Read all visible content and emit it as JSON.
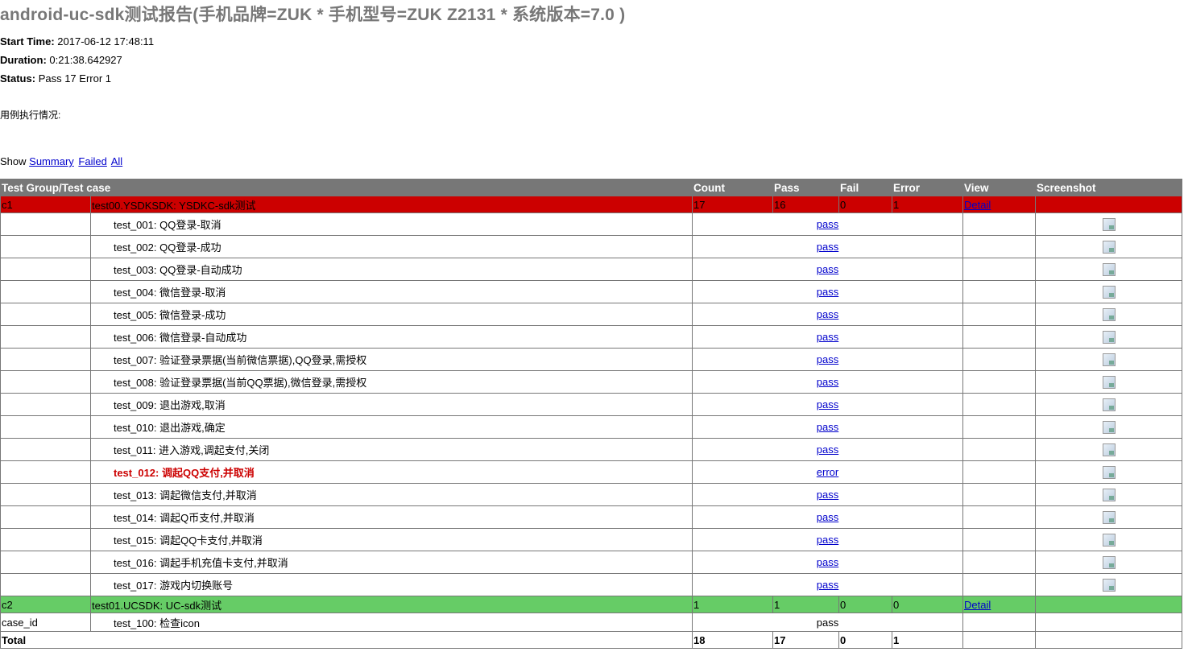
{
  "title": "android-uc-sdk测试报告(手机品牌=ZUK * 手机型号=ZUK Z2131 * 系统版本=7.0 )",
  "attributes": [
    {
      "label": "Start Time:",
      "value": "2017-06-12 17:48:11"
    },
    {
      "label": "Duration:",
      "value": "0:21:38.642927"
    },
    {
      "label": "Status:",
      "value": "Pass 17 Error 1"
    }
  ],
  "description": "用例执行情况:",
  "show": {
    "label": "Show",
    "summary": "Summary",
    "failed": "Failed",
    "all": "All"
  },
  "columns": [
    "Test Group/Test case",
    "Count",
    "Pass",
    "Fail",
    "Error",
    "View",
    "Screenshot"
  ],
  "groups": [
    {
      "id": "c1",
      "name": "test00.YSDKSDK: YSDKC-sdk测试",
      "count": "17",
      "pass": "16",
      "fail": "0",
      "error": "1",
      "view": "Detail",
      "cases": [
        {
          "name": "test_001: QQ登录-取消",
          "status": "pass"
        },
        {
          "name": "test_002: QQ登录-成功",
          "status": "pass"
        },
        {
          "name": "test_003: QQ登录-自动成功",
          "status": "pass"
        },
        {
          "name": "test_004: 微信登录-取消",
          "status": "pass"
        },
        {
          "name": "test_005: 微信登录-成功",
          "status": "pass"
        },
        {
          "name": "test_006: 微信登录-自动成功",
          "status": "pass"
        },
        {
          "name": "test_007: 验证登录票据(当前微信票据),QQ登录,需授权",
          "status": "pass"
        },
        {
          "name": "test_008: 验证登录票据(当前QQ票据),微信登录,需授权",
          "status": "pass"
        },
        {
          "name": "test_009: 退出游戏,取消",
          "status": "pass"
        },
        {
          "name": "test_010: 退出游戏,确定",
          "status": "pass"
        },
        {
          "name": "test_011: 进入游戏,调起支付,关闭",
          "status": "pass"
        },
        {
          "name": "test_012: 调起QQ支付,并取消",
          "status": "error"
        },
        {
          "name": "test_013: 调起微信支付,并取消",
          "status": "pass"
        },
        {
          "name": "test_014: 调起Q币支付,并取消",
          "status": "pass"
        },
        {
          "name": "test_015: 调起QQ卡支付,并取消",
          "status": "pass"
        },
        {
          "name": "test_016: 调起手机充值卡支付,并取消",
          "status": "pass"
        },
        {
          "name": "test_017: 游戏内切换账号",
          "status": "pass"
        }
      ]
    },
    {
      "id": "c2",
      "name": "test01.UCSDK: UC-sdk测试",
      "count": "1",
      "pass": "1",
      "fail": "0",
      "error": "0",
      "view": "Detail",
      "cases": [
        {
          "id": "case_id",
          "name": "test_100: 检查icon",
          "status": "pass"
        }
      ]
    }
  ],
  "total": {
    "label": "Total",
    "count": "18",
    "pass": "17",
    "fail": "0",
    "error": "1"
  }
}
